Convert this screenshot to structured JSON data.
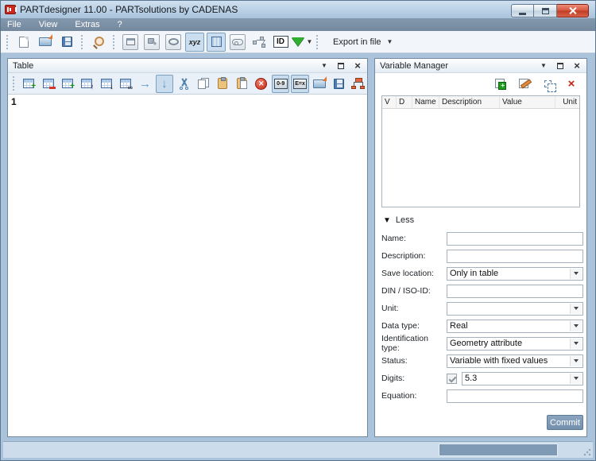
{
  "window": {
    "title": "PARTdesigner 11.00 - PARTsolutions by CADENAS"
  },
  "menu": {
    "items": [
      "File",
      "View",
      "Extras",
      "?"
    ]
  },
  "main_toolbar": {
    "xyz_label": "xyz",
    "id_label": "ID",
    "export_label": "Export in file"
  },
  "table_panel": {
    "title": "Table",
    "toolbar": {
      "digits_icon_label": "0-9",
      "equation_icon_label": "E=x"
    },
    "first_row_number": "1"
  },
  "variable_manager": {
    "title": "Variable Manager",
    "columns": [
      "V",
      "D",
      "Name",
      "Description",
      "Value",
      "Unit"
    ],
    "less_label": "Less",
    "form": {
      "name": {
        "label": "Name:",
        "value": ""
      },
      "description": {
        "label": "Description:",
        "value": ""
      },
      "save_location": {
        "label": "Save location:",
        "value": "Only in table"
      },
      "din_iso": {
        "label": "DIN / ISO-ID:",
        "value": ""
      },
      "unit": {
        "label": "Unit:",
        "value": ""
      },
      "data_type": {
        "label": "Data type:",
        "value": "Real"
      },
      "identification_type": {
        "label": "Identification type:",
        "value": "Geometry attribute"
      },
      "status": {
        "label": "Status:",
        "value": "Variable with fixed values"
      },
      "digits": {
        "label": "Digits:",
        "value": "5.3",
        "checked": "true"
      },
      "equation": {
        "label": "Equation:",
        "value": ""
      }
    },
    "commit_label": "Commit"
  },
  "colors": {
    "titlebar_top": "#cfe0f0",
    "menubar": "#7d92a7",
    "frame": "#aac3da",
    "pressed_button": "#c8dcee",
    "commit_button": "#7e9ab8",
    "close_button": "#c03a22",
    "accent_green": "#2fae2f",
    "accent_orange": "#e8762a"
  }
}
